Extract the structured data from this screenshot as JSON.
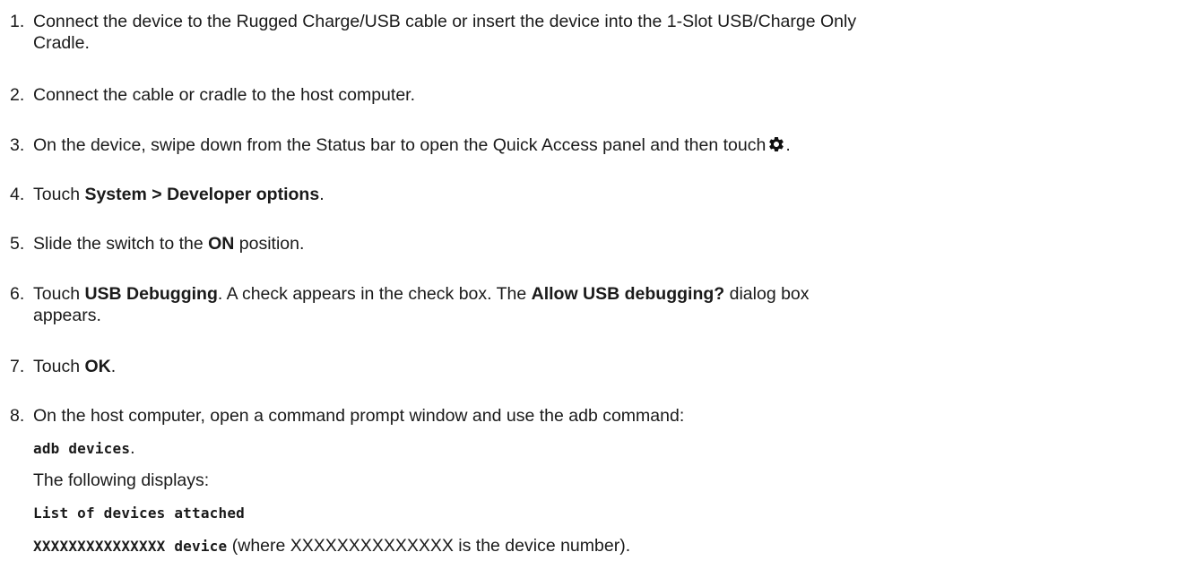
{
  "steps": [
    {
      "num": "1.",
      "line1": "Connect the device to the Rugged Charge/USB cable or insert the device into the 1-Slot USB/Charge Only",
      "line2": "Cradle."
    },
    {
      "num": "2.",
      "text": "Connect the cable or cradle to the host computer."
    },
    {
      "num": "3.",
      "text": "On the device, swipe down from the Status bar to open the Quick Access panel and then touch",
      "icon": "gear-icon",
      "after": "."
    },
    {
      "num": "4.",
      "pre": "Touch ",
      "bold1": "System",
      "mid": " > ",
      "bold2": "Developer options",
      "post": "."
    },
    {
      "num": "5.",
      "pre": "Slide the switch to the ",
      "bold": "ON",
      "post": " position."
    },
    {
      "num": "6.",
      "pre": "Touch ",
      "bold1": "USB Debugging",
      "mid": ". A check appears in the check box. The ",
      "bold2": "Allow USB debugging?",
      "post": " dialog box",
      "line2": "appears."
    },
    {
      "num": "7.",
      "pre": "Touch ",
      "bold": "OK",
      "post": "."
    },
    {
      "num": "8.",
      "text": "On the host computer, open a command prompt window and use the adb command:",
      "command": "adb devices",
      "command_post": ".",
      "displays": "The following displays:",
      "output1": "List of devices attached",
      "output2": "XXXXXXXXXXXXXXX device",
      "output2_post": " (where XXXXXXXXXXXXXX is the device number)."
    }
  ]
}
